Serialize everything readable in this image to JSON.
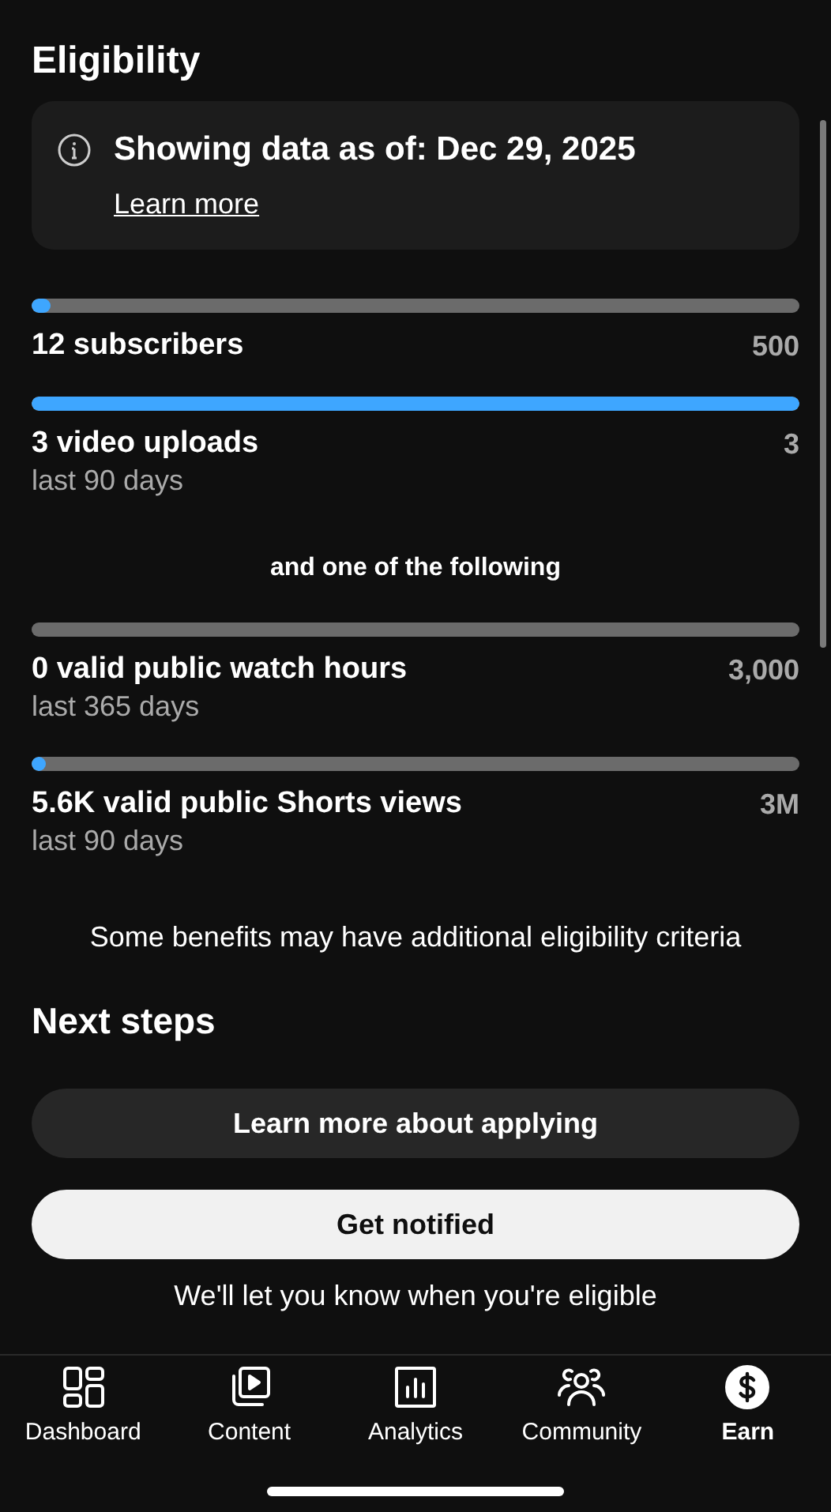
{
  "title": "Eligibility",
  "notice": {
    "text": "Showing data as of: Dec 29, 2025",
    "link": "Learn more"
  },
  "requirements_top": [
    {
      "label": "12 subscribers",
      "target": "500",
      "level": 0.024
    },
    {
      "label": "3 video uploads",
      "sublabel": "last 90 days",
      "target": "3",
      "level": 1
    }
  ],
  "separator": "and one of the following",
  "requirements_bottom": [
    {
      "label": "0 valid public watch hours",
      "sublabel": "last 365 days",
      "target": "3,000"
    },
    {
      "label": "5.6K valid public Shorts views",
      "sublabel": "last 90 days",
      "target": "3M",
      "level": 0.002
    }
  ],
  "footnote": "Some benefits may have additional eligibility criteria",
  "next_steps": {
    "title": "Next steps",
    "buttons": [
      {
        "label": "Learn more about applying",
        "kind": "secondary"
      },
      {
        "label": "Get notified",
        "kind": "primary"
      }
    ],
    "caption": "We'll let you know when you're eligible"
  },
  "nav": [
    {
      "label": "Dashboard",
      "kind": "dashboard",
      "selected": false
    },
    {
      "label": "Content",
      "kind": "content",
      "selected": false
    },
    {
      "label": "Analytics",
      "kind": "analytics",
      "selected": false
    },
    {
      "label": "Community",
      "kind": "community",
      "selected": false
    },
    {
      "label": "Earn",
      "kind": "earn",
      "selected": true
    }
  ]
}
